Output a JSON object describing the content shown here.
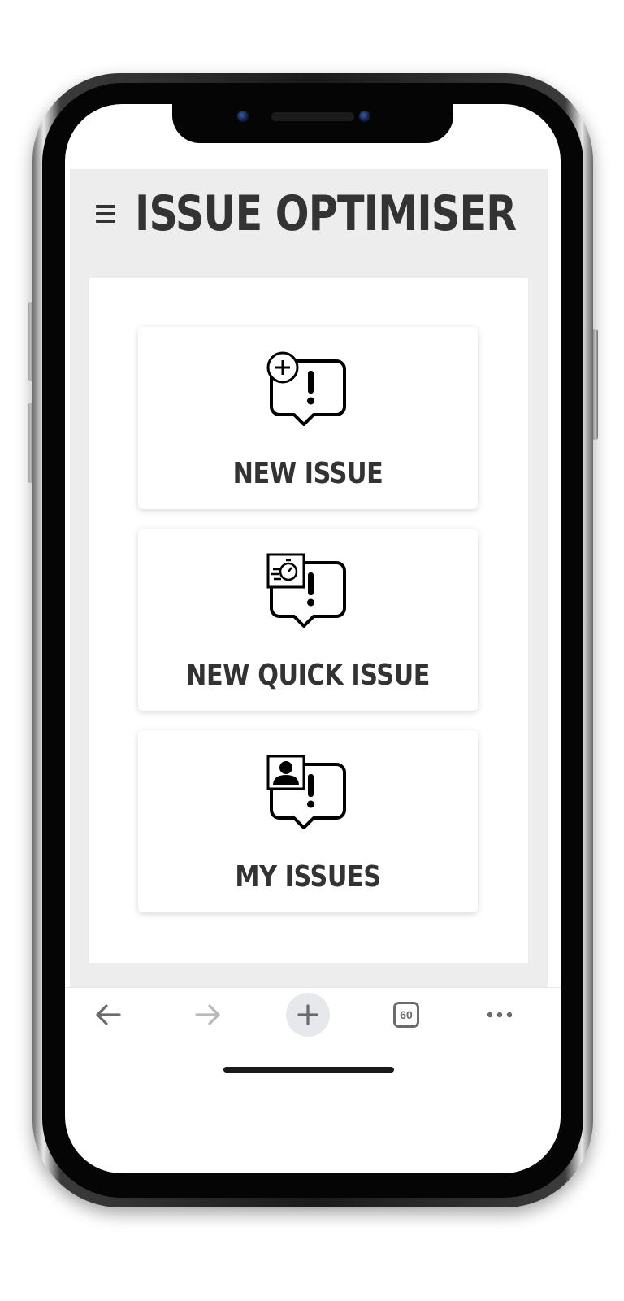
{
  "app": {
    "title": "ISSUE OPTIMISER"
  },
  "menu": [
    {
      "label": "NEW ISSUE",
      "icon": "new-issue-icon"
    },
    {
      "label": "NEW QUICK ISSUE",
      "icon": "quick-issue-icon"
    },
    {
      "label": "MY ISSUES",
      "icon": "my-issues-icon"
    }
  ],
  "browser": {
    "tab_count": "60",
    "buttons": [
      "back-arrow-icon",
      "forward-arrow-icon",
      "new-tab-plus-icon",
      "tabs-count-icon",
      "more-dots-icon"
    ]
  },
  "colors": {
    "text": "#333333",
    "page_bg": "#ededed",
    "panel_bg": "#ffffff",
    "toolbar_icon": "#6b6b6b"
  }
}
